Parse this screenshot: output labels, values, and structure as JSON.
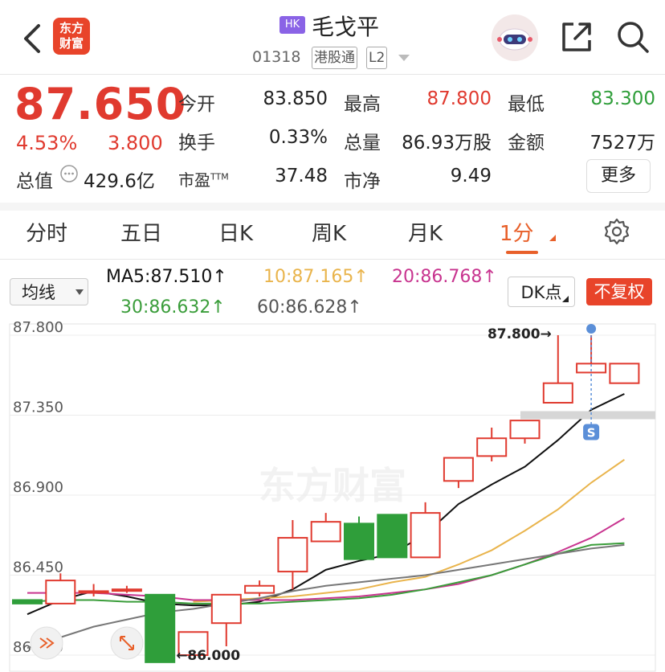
{
  "header": {
    "logo_line1": "东方",
    "logo_line2": "财富",
    "market_badge": "HK",
    "stock_name": "毛戈平",
    "stock_code": "01318",
    "tag_connect": "港股通",
    "tag_level": "L2"
  },
  "quote": {
    "price": "87.650",
    "change_pct": "4.53%",
    "change_abs": "3.800",
    "open_label": "今开",
    "open_value": "83.850",
    "high_label": "最高",
    "high_value": "87.800",
    "low_label": "最低",
    "low_value": "83.300",
    "turnover_label": "换手",
    "turnover_value": "0.33%",
    "volume_label": "总量",
    "volume_value": "86.93万股",
    "amount_label": "金额",
    "amount_value": "7527万",
    "mcap_label": "总值",
    "mcap_value": "429.6亿",
    "pe_label": "市盈",
    "pe_sup": "TTM",
    "pe_value": "37.48",
    "pb_label": "市净",
    "pb_value": "9.49",
    "more_label": "更多"
  },
  "tabs": [
    "分时",
    "五日",
    "日K",
    "周K",
    "月K",
    "1分"
  ],
  "active_tab": "1分",
  "ma_bar": {
    "select_label": "均线",
    "ma5": "MA5:87.510↑",
    "ma10": "10:87.165↑",
    "ma20": "20:86.768↑",
    "ma30": "30:86.632↑",
    "ma60": "60:86.628↑",
    "dk_label": "DK点",
    "fq_label": "不复权"
  },
  "colors": {
    "up": "#e03a2f",
    "down": "#2f9e3a",
    "accent": "#e8602a",
    "ma5": "#111111",
    "ma10": "#e9b44c",
    "ma20": "#c8348f",
    "ma30": "#3a9d3a",
    "ma60": "#777777"
  },
  "chart_data": {
    "type": "candlestick",
    "y_ticks": [
      "87.800",
      "87.350",
      "86.900",
      "86.450",
      "86.000"
    ],
    "ylim": [
      86.0,
      87.8
    ],
    "watermark": "东方财富",
    "max_label": "87.800→",
    "min_label": "←86.000",
    "marker_label": "S",
    "candles": [
      {
        "o": 86.31,
        "c": 86.29,
        "h": 86.31,
        "l": 86.29
      },
      {
        "o": 86.29,
        "c": 86.42,
        "h": 86.46,
        "l": 86.29
      },
      {
        "o": 86.36,
        "c": 86.36,
        "h": 86.4,
        "l": 86.33
      },
      {
        "o": 86.37,
        "c": 86.37,
        "h": 86.39,
        "l": 86.35
      },
      {
        "o": 86.34,
        "c": 85.96,
        "h": 86.34,
        "l": 85.96
      },
      {
        "o": 86.0,
        "c": 86.13,
        "h": 86.13,
        "l": 86.0
      },
      {
        "o": 86.18,
        "c": 86.34,
        "h": 86.34,
        "l": 86.05
      },
      {
        "o": 86.35,
        "c": 86.39,
        "h": 86.42,
        "l": 86.33
      },
      {
        "o": 86.47,
        "c": 86.66,
        "h": 86.76,
        "l": 86.37
      },
      {
        "o": 86.64,
        "c": 86.75,
        "h": 86.8,
        "l": 86.64
      },
      {
        "o": 86.74,
        "c": 86.54,
        "h": 86.78,
        "l": 86.54
      },
      {
        "o": 86.79,
        "c": 86.55,
        "h": 86.79,
        "l": 86.55
      },
      {
        "o": 86.55,
        "c": 86.8,
        "h": 86.86,
        "l": 86.55
      },
      {
        "o": 86.98,
        "c": 87.11,
        "h": 87.11,
        "l": 86.94
      },
      {
        "o": 87.12,
        "c": 87.22,
        "h": 87.28,
        "l": 87.09
      },
      {
        "o": 87.22,
        "c": 87.32,
        "h": 87.32,
        "l": 87.19
      },
      {
        "o": 87.42,
        "c": 87.53,
        "h": 87.8,
        "l": 87.42
      },
      {
        "o": 87.59,
        "c": 87.64,
        "h": 87.8,
        "l": 87.59
      },
      {
        "o": 87.53,
        "c": 87.64,
        "h": 87.64,
        "l": 87.53
      }
    ],
    "series": [
      {
        "name": "MA5",
        "values": [
          86.23,
          86.31,
          86.36,
          86.33,
          86.29,
          86.28,
          86.28,
          86.3,
          86.37,
          86.48,
          86.53,
          86.57,
          86.68,
          86.85,
          86.96,
          87.06,
          87.21,
          87.38,
          87.47
        ]
      },
      {
        "name": "MA10",
        "values": [
          null,
          null,
          null,
          null,
          null,
          86.3,
          86.31,
          86.32,
          86.33,
          86.35,
          86.37,
          86.41,
          86.44,
          86.51,
          86.59,
          86.7,
          86.82,
          86.97,
          87.1
        ]
      },
      {
        "name": "MA20",
        "values": [
          86.35,
          86.35,
          86.35,
          86.34,
          86.33,
          86.31,
          86.31,
          86.31,
          86.31,
          86.32,
          86.33,
          86.35,
          86.37,
          86.4,
          86.45,
          86.51,
          86.58,
          86.66,
          86.77
        ]
      },
      {
        "name": "MA30",
        "values": [
          86.3,
          86.31,
          86.31,
          86.3,
          86.3,
          86.29,
          86.29,
          86.29,
          86.3,
          86.31,
          86.32,
          86.34,
          86.37,
          86.41,
          86.45,
          86.51,
          86.57,
          86.62,
          86.63
        ]
      },
      {
        "name": "MA60",
        "values": [
          86.04,
          86.1,
          86.16,
          86.2,
          86.24,
          86.26,
          86.29,
          86.32,
          86.36,
          86.39,
          86.41,
          86.43,
          86.45,
          86.48,
          86.51,
          86.54,
          86.57,
          86.6,
          86.62
        ]
      }
    ]
  }
}
